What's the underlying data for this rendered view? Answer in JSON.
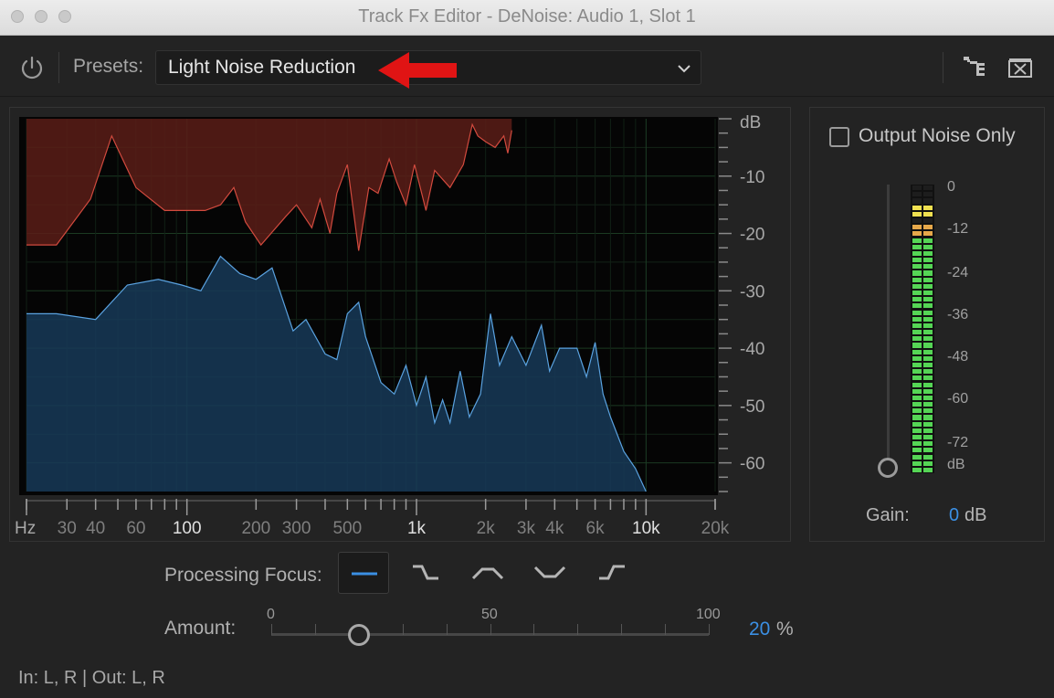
{
  "window": {
    "title": "Track Fx Editor - DeNoise: Audio 1, Slot 1"
  },
  "toolbar": {
    "presets_label": "Presets:",
    "preset_value": "Light Noise Reduction",
    "icons": [
      "power-icon",
      "chevron-down-icon",
      "routing-icon",
      "close-panel-icon"
    ],
    "annotation_arrow_color": "#e01414"
  },
  "graph": {
    "db_unit": "dB",
    "hz_unit": "Hz",
    "db_ticks": [
      "-10",
      "-20",
      "-30",
      "-40",
      "-50",
      "-60"
    ],
    "freq_labels": [
      "30",
      "40",
      "60",
      "100",
      "200",
      "300",
      "500",
      "1k",
      "2k",
      "3k",
      "4k",
      "6k",
      "10k",
      "20k"
    ],
    "colors": {
      "noise": "#7a2820",
      "signal": "#1f4a6e"
    }
  },
  "chart_data": {
    "type": "area",
    "xlabel": "Hz",
    "ylabel": "dB",
    "x_scale": "log",
    "xlim": [
      20,
      20000
    ],
    "ylim": [
      -65,
      0
    ],
    "series": [
      {
        "points": [
          [
            20,
            -22
          ],
          [
            27,
            -22
          ],
          [
            38,
            -14
          ],
          [
            47,
            -3
          ],
          [
            60,
            -12
          ],
          [
            80,
            -16
          ],
          [
            120,
            -16
          ],
          [
            140,
            -15
          ],
          [
            160,
            -12
          ],
          [
            180,
            -18
          ],
          [
            210,
            -22
          ],
          [
            270,
            -17
          ],
          [
            300,
            -15
          ],
          [
            350,
            -19
          ],
          [
            380,
            -14
          ],
          [
            420,
            -20
          ],
          [
            450,
            -13
          ],
          [
            500,
            -8
          ],
          [
            560,
            -23
          ],
          [
            620,
            -12
          ],
          [
            680,
            -13
          ],
          [
            760,
            -7
          ],
          [
            820,
            -11
          ],
          [
            900,
            -15
          ],
          [
            980,
            -8
          ],
          [
            1100,
            -16
          ],
          [
            1200,
            -9
          ],
          [
            1400,
            -12
          ],
          [
            1600,
            -8
          ],
          [
            1750,
            -1
          ],
          [
            1850,
            -3
          ],
          [
            2000,
            -4
          ],
          [
            2200,
            -5
          ],
          [
            2400,
            -3
          ],
          [
            2500,
            -6
          ],
          [
            2600,
            -2
          ]
        ]
      },
      {
        "points": [
          [
            20,
            -34
          ],
          [
            27,
            -34
          ],
          [
            40,
            -35
          ],
          [
            55,
            -29
          ],
          [
            75,
            -28
          ],
          [
            95,
            -29
          ],
          [
            115,
            -30
          ],
          [
            140,
            -24
          ],
          [
            170,
            -27
          ],
          [
            200,
            -28
          ],
          [
            235,
            -26
          ],
          [
            290,
            -37
          ],
          [
            330,
            -35
          ],
          [
            400,
            -41
          ],
          [
            450,
            -42
          ],
          [
            500,
            -34
          ],
          [
            560,
            -32
          ],
          [
            600,
            -38
          ],
          [
            700,
            -46
          ],
          [
            800,
            -48
          ],
          [
            900,
            -43
          ],
          [
            1000,
            -50
          ],
          [
            1100,
            -45
          ],
          [
            1200,
            -53
          ],
          [
            1300,
            -49
          ],
          [
            1400,
            -53
          ],
          [
            1550,
            -44
          ],
          [
            1700,
            -52
          ],
          [
            1900,
            -48
          ],
          [
            2100,
            -34
          ],
          [
            2300,
            -43
          ],
          [
            2600,
            -38
          ],
          [
            3000,
            -43
          ],
          [
            3500,
            -36
          ],
          [
            3800,
            -44
          ],
          [
            4200,
            -40
          ],
          [
            5000,
            -40
          ],
          [
            5500,
            -45
          ],
          [
            6000,
            -39
          ],
          [
            6500,
            -48
          ],
          [
            7000,
            -52
          ],
          [
            8000,
            -58
          ],
          [
            9000,
            -61
          ],
          [
            10000,
            -65
          ]
        ]
      }
    ]
  },
  "output_noise_only": {
    "label": "Output Noise Only",
    "checked": false
  },
  "meter": {
    "scale": [
      "0",
      "-12",
      "-24",
      "-36",
      "-48",
      "-60",
      "-72",
      "dB"
    ],
    "colors": {
      "low": "#55d555",
      "mid": "#e6a84a",
      "high": "#f0e050"
    },
    "level_db": -12
  },
  "gain": {
    "label": "Gain:",
    "value": "0",
    "unit": "dB"
  },
  "processing_focus": {
    "label": "Processing Focus:",
    "options": [
      "focus-all-icon",
      "focus-low-icon",
      "focus-mid-icon",
      "focus-high-mid-icon",
      "focus-high-icon"
    ],
    "selected_index": 0
  },
  "amount": {
    "label": "Amount:",
    "scale": [
      "0",
      "50",
      "100"
    ],
    "value": "20",
    "unit": "%",
    "fraction": 0.2
  },
  "io_status": "In: L, R | Out: L, R"
}
